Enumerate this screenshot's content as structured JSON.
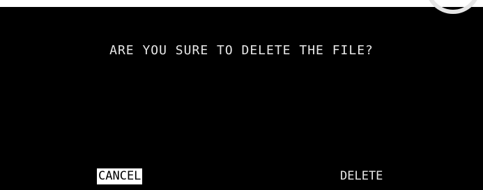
{
  "dialog": {
    "message": "ARE YOU SURE TO DELETE THE FILE?",
    "cancel_label": "CANCEL",
    "delete_label": "DELETE",
    "selected_button": "CANCEL"
  },
  "colors": {
    "background": "#000000",
    "text": "#e8e8e8",
    "selected_background": "#ffffff",
    "selected_text": "#000000"
  }
}
